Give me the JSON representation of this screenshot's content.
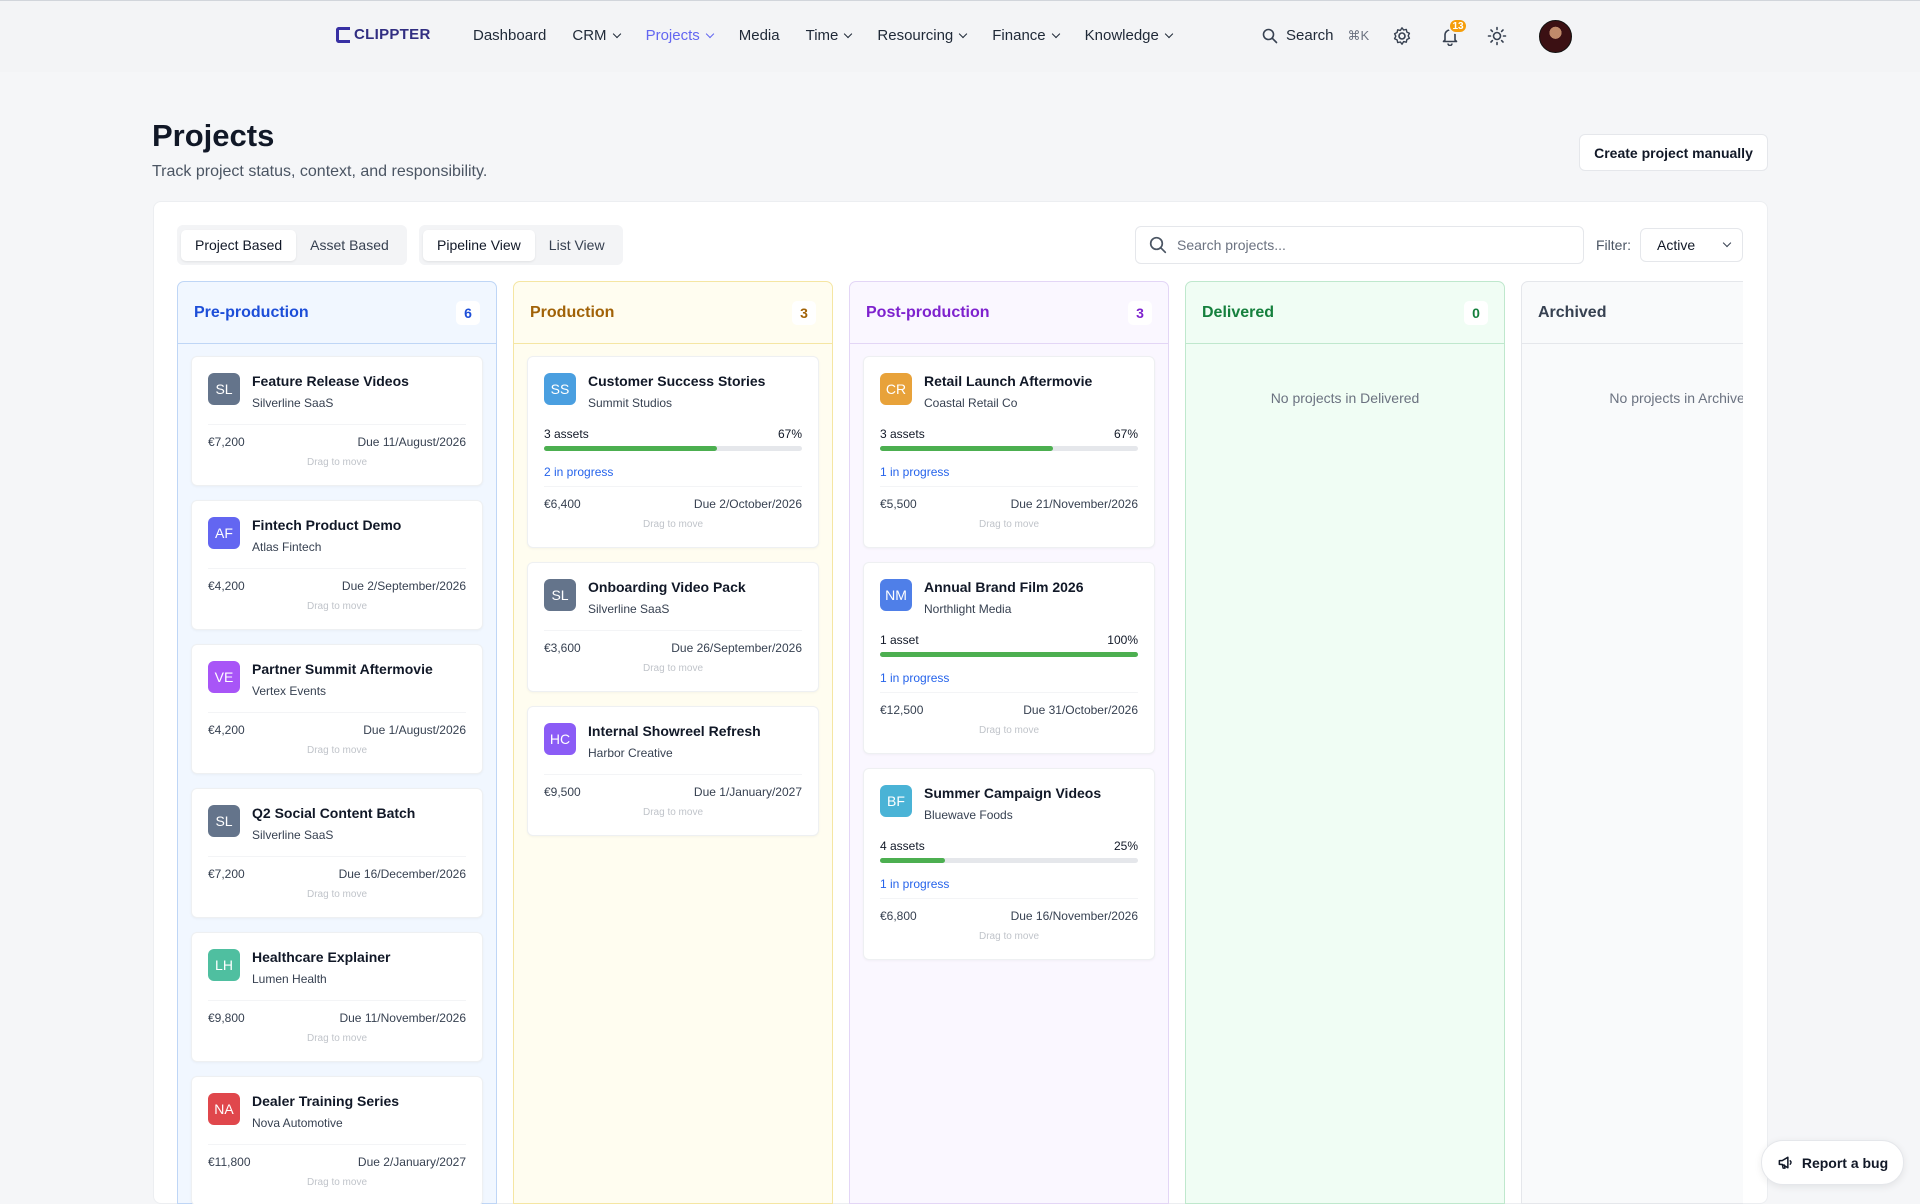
{
  "app": {
    "logo_text": "CLIPPTER"
  },
  "nav": [
    {
      "label": "Dashboard",
      "has_menu": false,
      "active": false
    },
    {
      "label": "CRM",
      "has_menu": true,
      "active": false
    },
    {
      "label": "Projects",
      "has_menu": true,
      "active": true
    },
    {
      "label": "Media",
      "has_menu": false,
      "active": false
    },
    {
      "label": "Time",
      "has_menu": true,
      "active": false
    },
    {
      "label": "Resourcing",
      "has_menu": true,
      "active": false
    },
    {
      "label": "Finance",
      "has_menu": true,
      "active": false
    },
    {
      "label": "Knowledge",
      "has_menu": true,
      "active": false
    }
  ],
  "header": {
    "search_label": "Search",
    "search_shortcut": "⌘K",
    "notification_count": "13"
  },
  "page": {
    "title": "Projects",
    "subtitle": "Track project status, context, and responsibility.",
    "create_button": "Create project manually"
  },
  "toolbar": {
    "mode_tabs": [
      "Project Based",
      "Asset Based"
    ],
    "mode_selected": "Project Based",
    "view_tabs": [
      "Pipeline View",
      "List View"
    ],
    "view_selected": "Pipeline View",
    "search_placeholder": "Search projects...",
    "filter_label": "Filter:",
    "filter_value": "Active"
  },
  "drag_hint": "Drag to move",
  "columns": [
    {
      "title": "Pre-production",
      "count": "6",
      "color": "#1d4ed8",
      "bg": "#f1f7ff",
      "border": "#bfd6f6",
      "empty_text": "",
      "cards": [
        {
          "initials": "SL",
          "chip_color": "#64748b",
          "title": "Feature Release Videos",
          "client": "Silverline SaaS",
          "amount": "€7,200",
          "due": "Due 11/August/2026"
        },
        {
          "initials": "AF",
          "chip_color": "#6366f1",
          "title": "Fintech Product Demo",
          "client": "Atlas Fintech",
          "amount": "€4,200",
          "due": "Due 2/September/2026"
        },
        {
          "initials": "VE",
          "chip_color": "#a855f7",
          "title": "Partner Summit Aftermovie",
          "client": "Vertex Events",
          "amount": "€4,200",
          "due": "Due 1/August/2026"
        },
        {
          "initials": "SL",
          "chip_color": "#64748b",
          "title": "Q2 Social Content Batch",
          "client": "Silverline SaaS",
          "amount": "€7,200",
          "due": "Due 16/December/2026"
        },
        {
          "initials": "LH",
          "chip_color": "#4fbfa0",
          "title": "Healthcare Explainer",
          "client": "Lumen Health",
          "amount": "€9,800",
          "due": "Due 11/November/2026"
        },
        {
          "initials": "NA",
          "chip_color": "#e0474c",
          "title": "Dealer Training Series",
          "client": "Nova Automotive",
          "amount": "€11,800",
          "due": "Due 2/January/2027"
        }
      ]
    },
    {
      "title": "Production",
      "count": "3",
      "color": "#a16207",
      "bg": "#fffdf0",
      "border": "#f5e6a3",
      "empty_text": "",
      "cards": [
        {
          "initials": "SS",
          "chip_color": "#4a9fe0",
          "title": "Customer Success Stories",
          "client": "Summit Studios",
          "assets": "3 assets",
          "progress": 67,
          "progress_label": "67%",
          "status": "2 in progress",
          "amount": "€6,400",
          "due": "Due 2/October/2026"
        },
        {
          "initials": "SL",
          "chip_color": "#64748b",
          "title": "Onboarding Video Pack",
          "client": "Silverline SaaS",
          "amount": "€3,600",
          "due": "Due 26/September/2026"
        },
        {
          "initials": "HC",
          "chip_color": "#8b5cf6",
          "title": "Internal Showreel Refresh",
          "client": "Harbor Creative",
          "amount": "€9,500",
          "due": "Due 1/January/2027"
        }
      ]
    },
    {
      "title": "Post-production",
      "count": "3",
      "color": "#7e22ce",
      "bg": "#faf7ff",
      "border": "#e3d6f6",
      "empty_text": "",
      "cards": [
        {
          "initials": "CR",
          "chip_color": "#e8a23a",
          "title": "Retail Launch Aftermovie",
          "client": "Coastal Retail Co",
          "assets": "3 assets",
          "progress": 67,
          "progress_label": "67%",
          "status": "1 in progress",
          "amount": "€5,500",
          "due": "Due 21/November/2026"
        },
        {
          "initials": "NM",
          "chip_color": "#4f7fe8",
          "title": "Annual Brand Film 2026",
          "client": "Northlight Media",
          "assets": "1 asset",
          "progress": 100,
          "progress_label": "100%",
          "status": "1 in progress",
          "amount": "€12,500",
          "due": "Due 31/October/2026"
        },
        {
          "initials": "BF",
          "chip_color": "#4ab3d6",
          "title": "Summer Campaign Videos",
          "client": "Bluewave Foods",
          "assets": "4 assets",
          "progress": 25,
          "progress_label": "25%",
          "status": "1 in progress",
          "amount": "€6,800",
          "due": "Due 16/November/2026"
        }
      ]
    },
    {
      "title": "Delivered",
      "count": "0",
      "color": "#15803d",
      "bg": "#f0fdf4",
      "border": "#bfe8cd",
      "empty_text": "No projects in Delivered",
      "cards": []
    },
    {
      "title": "Archived",
      "count": "",
      "color": "#374151",
      "bg": "#f9fafb",
      "border": "#e5e7eb",
      "empty_text": "No projects in Archived",
      "cards": []
    }
  ],
  "report_bug": "Report a bug"
}
